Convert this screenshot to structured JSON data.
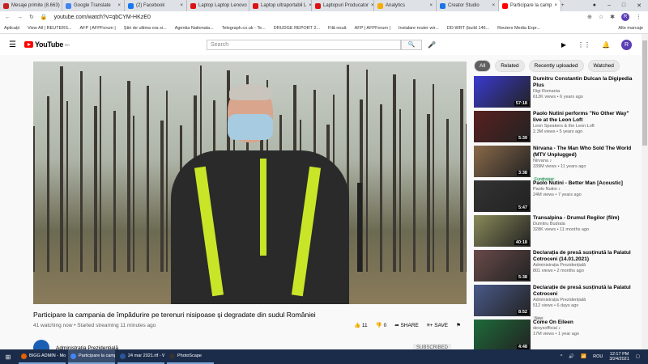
{
  "browser": {
    "tabs": [
      {
        "label": "Mesaje primite (8.663)",
        "color": "#c5221f"
      },
      {
        "label": "Google Translate",
        "color": "#4285f4"
      },
      {
        "label": "(2) Facebook",
        "color": "#1877f2"
      },
      {
        "label": "Laptop Laptop Lenovo",
        "color": "#d11"
      },
      {
        "label": "Laptop ultraportabil L",
        "color": "#d11"
      },
      {
        "label": "Laptopuri Producator",
        "color": "#d11"
      },
      {
        "label": "Analytics",
        "color": "#f9ab00"
      },
      {
        "label": "Creator Studio",
        "color": "#1a73e8"
      },
      {
        "label": "Participare la camp",
        "color": "#f00",
        "active": true
      }
    ],
    "new_tab": "+",
    "url": "youtube.com/watch?v=qbCYM-HKzE0",
    "profile_initial": "R",
    "bookmarks": [
      "Aplicații",
      "View All | REUTERS...",
      "AFP | AFPForum |",
      "Știri de ultima ora si...",
      "Agentia Nationala...",
      "Telegraph.co.uk - Te...",
      "DRUDGE REPORT 2...",
      "Filă nouă",
      "AFP | AFPForum |",
      "Instalare router wir...",
      "DD-WRT (build 146...",
      "Reuters Media Expr..."
    ],
    "other_bookmarks": "Alte marcaje"
  },
  "youtube": {
    "logo": "YouTube",
    "region": "RO",
    "search_placeholder": "Search",
    "avatar_initial": "R",
    "video": {
      "title": "Participare la campania de împădurire pe terenuri nisipoase și degradate din sudul României",
      "meta": "41 watching now • Started streaming 11 minutes ago",
      "likes": "11",
      "dislikes": "0",
      "share": "SHARE",
      "save": "SAVE",
      "channel": "Administrația Prezidențială",
      "subscribe": "SUBSCRIBED"
    },
    "chips": [
      "All",
      "Related",
      "Recently uploaded",
      "Watched"
    ],
    "recommendations": [
      {
        "title": "Dumitru Constantin Dulcan la Digipedia Plus",
        "channel": "Digi Romania",
        "views": "612K views • 6 years ago",
        "duration": "57:18",
        "thumb": "#3a3ad0"
      },
      {
        "title": "Paolo Nutini performs \"No Other Way\" live at the Leon Loft",
        "channel": "Leon Speakers & the Leon Loft",
        "views": "2.3M views • 5 years ago",
        "duration": "5:39",
        "thumb": "#5a2020"
      },
      {
        "title": "Nirvana - The Man Who Sold The World (MTV Unplugged)",
        "channel": "Nirvana ♪",
        "views": "339M views • 11 years ago",
        "duration": "3:38",
        "thumb": "#8a6a4a",
        "badge": "Fundraiser"
      },
      {
        "title": "Paolo Nutini - Better Man [Acoustic]",
        "channel": "Paolo Nutini ♪",
        "views": "24M views • 7 years ago",
        "duration": "5:47",
        "thumb": "#333"
      },
      {
        "title": "Transalpina - Drumul Regilor (film)",
        "channel": "Dumitru Budrala",
        "views": "328K views • 11 months ago",
        "duration": "40:18",
        "thumb": "#8a8a5a"
      },
      {
        "title": "Declarația de presă susținută la Palatul Cotroceni (14.01.2021)",
        "channel": "Administrația Prezidențială",
        "views": "801 views • 2 months ago",
        "duration": "5:38",
        "thumb": "#6a4a4a"
      },
      {
        "title": "Declarație de presă susținută la Palatul Cotroceni",
        "channel": "Administrația Prezidențială",
        "views": "512 views • 6 days ago",
        "duration": "8:52",
        "thumb": "#4a5a8a",
        "badge": "New"
      },
      {
        "title": "Come On Eileen",
        "channel": "dexysofficial ♪",
        "views": "17M views • 1 year ago",
        "duration": "4:48",
        "thumb": "#1e6b3a"
      }
    ]
  },
  "taskbar": {
    "items": [
      "BIGG ADMIN - Moz...",
      "Participare la camp...",
      "24 mar 2021.rtf - W...",
      "PhotoScape"
    ],
    "lang": "ROU",
    "time": "12:17 PM",
    "date": "3/24/2021"
  }
}
